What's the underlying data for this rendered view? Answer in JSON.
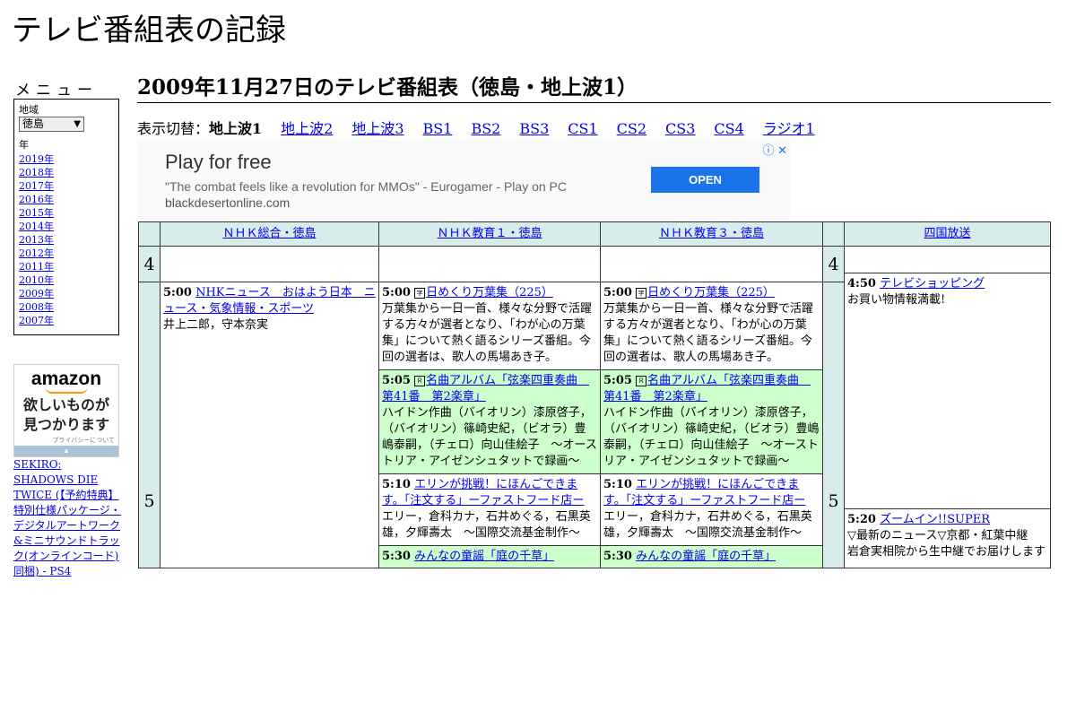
{
  "site": {
    "title": "テレビ番組表の記録"
  },
  "menu": {
    "heading": "メニュー",
    "region_label": "地域",
    "region_value": "徳島",
    "year_label": "年",
    "years": [
      "2019年",
      "2018年",
      "2017年",
      "2016年",
      "2015年",
      "2014年",
      "2013年",
      "2012年",
      "2011年",
      "2010年",
      "2009年",
      "2008年",
      "2007年"
    ]
  },
  "side_ad": {
    "logo": "amazon",
    "line1": "欲しいものが",
    "line2": "見つかります",
    "privacy": "プライバシーについて"
  },
  "product_link": "SEKIRO: SHADOWS DIE TWICE (【予約特典】特別仕様パッケージ・デジタルアートワーク&ミニサウンドトラック(オンラインコード) 同梱) - PS4",
  "page_heading": "2009年11月27日のテレビ番組表（徳島・地上波1）",
  "switcher": {
    "label": "表示切替：",
    "current": "地上波1",
    "links": [
      "地上波2",
      "地上波3",
      "BS1",
      "BS2",
      "BS3",
      "CS1",
      "CS2",
      "CS3",
      "CS4",
      "ラジオ1"
    ]
  },
  "banner_ad": {
    "headline": "Play for free",
    "quote": "\"The combat feels like a revolution for MMOs\" - Eurogamer - Play on PC",
    "domain": "blackdesertonline.com",
    "button": "OPEN"
  },
  "schedule": {
    "channels": [
      "ＮＨＫ総合・徳島",
      "ＮＨＫ教育１・徳島",
      "ＮＨＫ教育３・徳島",
      "四国放送"
    ],
    "hours": [
      "4",
      "5"
    ],
    "programs": {
      "nhk_sogo": [
        {
          "time": "5:00",
          "title": "NHKニュース　おはよう日本　ニュース・気象情報・スポーツ",
          "desc": "井上二郎，守本奈実"
        }
      ],
      "nhk_kyoiku1": [
        {
          "time": "5:00",
          "icon": "字",
          "title": "日めくり万葉集（225）",
          "desc": "万葉集から一日一首、様々な分野で活躍する方々が選者となり、「わが心の万葉集」について熱く語るシリーズ番組。今回の選者は、歌人の馬場あき子。"
        },
        {
          "time": "5:05",
          "icon": "Ｒ",
          "title": "名曲アルバム「弦楽四重奏曲　第41番　第2楽章」",
          "desc": "ハイドン作曲（バイオリン）漆原啓子，（バイオリン）篠崎史紀，（ビオラ）豊嶋泰嗣，（チェロ）向山佳絵子　～オーストリア・アイゼンシュタットで録画～"
        },
        {
          "time": "5:10",
          "title": "エリンが挑戦！にほんごできます。「注文する」ーファストフード店ー",
          "desc": "エリー，倉科カナ，石井めぐる，石黒英雄，夕輝壽太　～国際交流基金制作～"
        },
        {
          "time": "5:30",
          "title": "みんなの童謡「庭の千草」"
        }
      ],
      "nhk_kyoiku3": [
        {
          "time": "5:00",
          "icon": "字",
          "title": "日めくり万葉集（225）",
          "desc": "万葉集から一日一首、様々な分野で活躍する方々が選者となり、「わが心の万葉集」について熱く語るシリーズ番組。今回の選者は、歌人の馬場あき子。"
        },
        {
          "time": "5:05",
          "icon": "Ｒ",
          "title": "名曲アルバム「弦楽四重奏曲　第41番　第2楽章」",
          "desc": "ハイドン作曲（バイオリン）漆原啓子，（バイオリン）篠崎史紀，（ビオラ）豊嶋泰嗣，（チェロ）向山佳絵子　～オーストリア・アイゼンシュタットで録画～"
        },
        {
          "time": "5:10",
          "title": "エリンが挑戦！にほんごできます。「注文する」ーファストフード店ー",
          "desc": "エリー，倉科カナ，石井めぐる，石黒英雄，夕輝壽太　～国際交流基金制作～"
        },
        {
          "time": "5:30",
          "title": "みんなの童謡「庭の千草」"
        }
      ],
      "shikoku": [
        {
          "time": "4:50",
          "title": "テレビショッピング",
          "desc": "お買い物情報満載!"
        },
        {
          "time": "5:20",
          "title": "ズームイン!!SUPER",
          "desc": "▽最新のニュース▽京都・紅葉中継　岩倉実相院から生中継でお届けします"
        }
      ]
    }
  }
}
